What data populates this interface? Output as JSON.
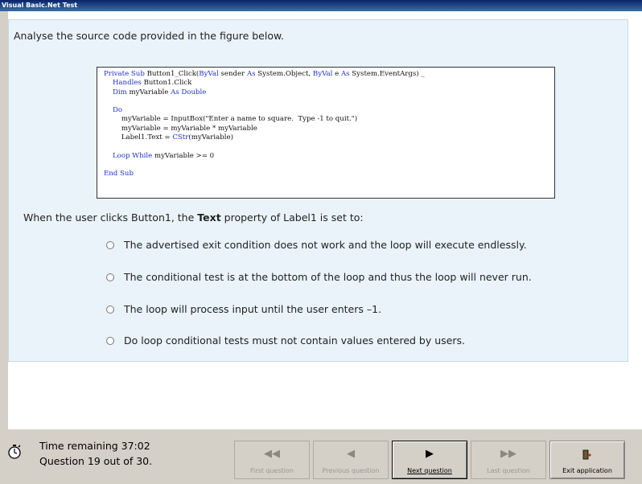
{
  "window": {
    "title": "Visual Basic.Net Test"
  },
  "question": {
    "intro": "Analyse the source code provided in the figure below.",
    "code_lines": [
      "Private Sub Button1_Click(ByVal sender As System.Object, ByVal e As System.EventArgs) _",
      "    Handles Button1.Click",
      "    Dim myVariable As Double",
      "",
      "    Do",
      "        myVariable = InputBox(\"Enter a name to square.  Type -1 to quit.\")",
      "        myVariable = myVariable * myVariable",
      "        Label1.Text = CStr(myVariable)",
      "",
      "    Loop While myVariable >= 0",
      "",
      "End Sub"
    ],
    "prompt_before": "When the user clicks Button1, the ",
    "prompt_bold": "Text",
    "prompt_after": " property of Label1 is set to:",
    "options": [
      "The advertised exit condition does not work and the loop will execute endlessly.",
      "The conditional test is at the bottom of the loop and thus the loop will never run.",
      "The loop will process input until the user enters –1.",
      "Do loop conditional tests must not contain values entered by users."
    ]
  },
  "status": {
    "time_remaining": "Time remaining 37:02",
    "question_count": "Question 19 out of 30."
  },
  "nav": {
    "first": "First question",
    "previous": "Previous question",
    "next": "Next question",
    "last": "Last question",
    "exit": "Exit application"
  },
  "colors": {
    "keyword": "#1f2fd0",
    "panel": "#eaf3fa",
    "titlebar": "#0a246a"
  }
}
